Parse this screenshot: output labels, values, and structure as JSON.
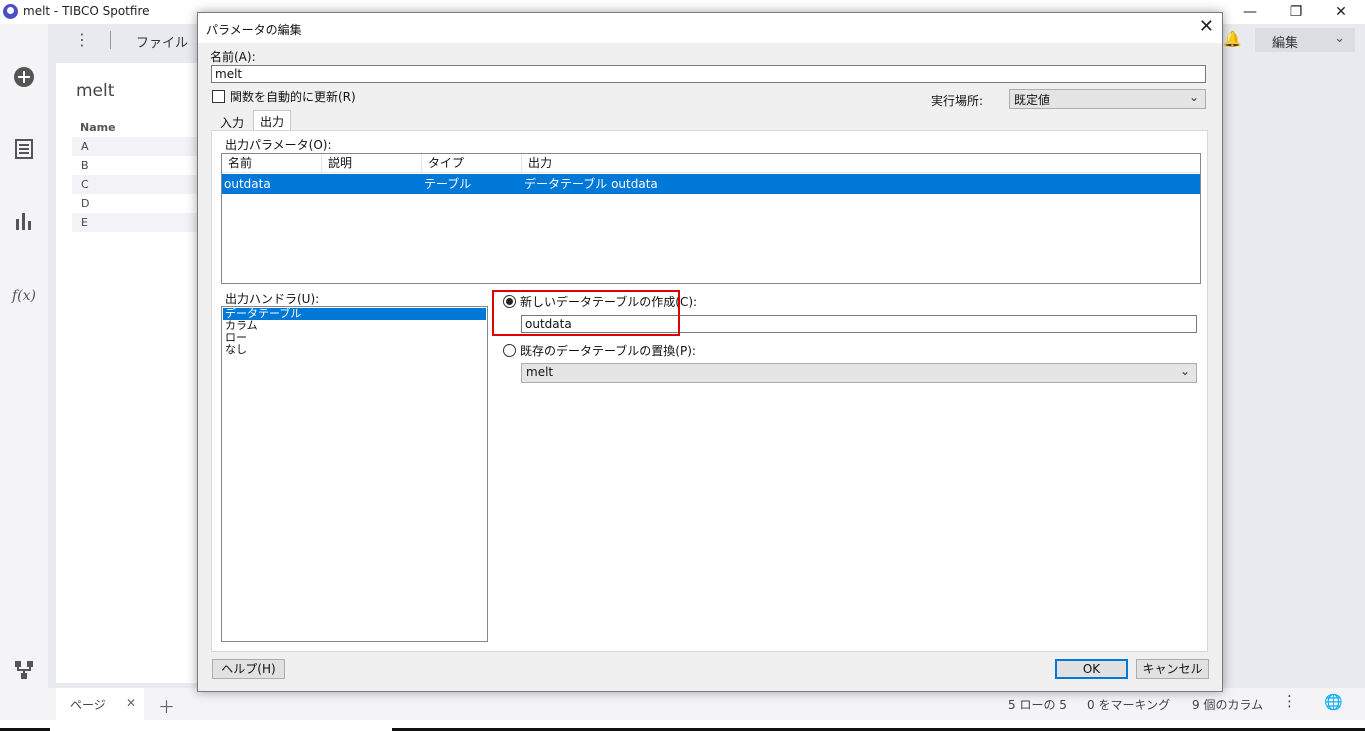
{
  "window": {
    "title": "melt - TIBCO Spotfire"
  },
  "toolbar": {
    "file_menu": "ファイル",
    "edit_label": "編集"
  },
  "sidebar_card": {
    "title": "melt",
    "column_header": "Name",
    "rows": [
      "A",
      "B",
      "C",
      "D",
      "E"
    ]
  },
  "statusbar": {
    "page_tab": "ページ",
    "rows": "5 ローの 5",
    "marking": "0 をマーキング",
    "columns": "9 個のカラム"
  },
  "dialog": {
    "title": "パラメータの編集",
    "name_label": "名前(A):",
    "name_value": "melt",
    "auto_update_label": "関数を自動的に更新(R)",
    "auto_update_checked": false,
    "exec_location_label": "実行場所:",
    "exec_location_value": "既定値",
    "tabs": [
      "入力",
      "出力"
    ],
    "active_tab": "出力",
    "output_params_label": "出力パラメータ(O):",
    "columns": [
      "名前",
      "説明",
      "タイプ",
      "出力"
    ],
    "rows": [
      {
        "name": "outdata",
        "description": "",
        "type": "テーブル",
        "output": "データテーブル outdata"
      }
    ],
    "handler_label": "出力ハンドラ(U):",
    "handlers": [
      "データテーブル",
      "カラム",
      "ロー",
      "なし"
    ],
    "selected_handler": "データテーブル",
    "new_table_label": "新しいデータテーブルの作成(C):",
    "new_table_value": "outdata",
    "replace_table_label": "既存のデータテーブルの置換(P):",
    "replace_table_value": "melt",
    "selected_option": "new",
    "help_button": "ヘルプ(H)",
    "ok_button": "OK",
    "cancel_button": "キャンセル"
  },
  "colors": {
    "selection": "#0078d7",
    "highlight_border": "#e00000",
    "accent": "#4b4fc4"
  }
}
